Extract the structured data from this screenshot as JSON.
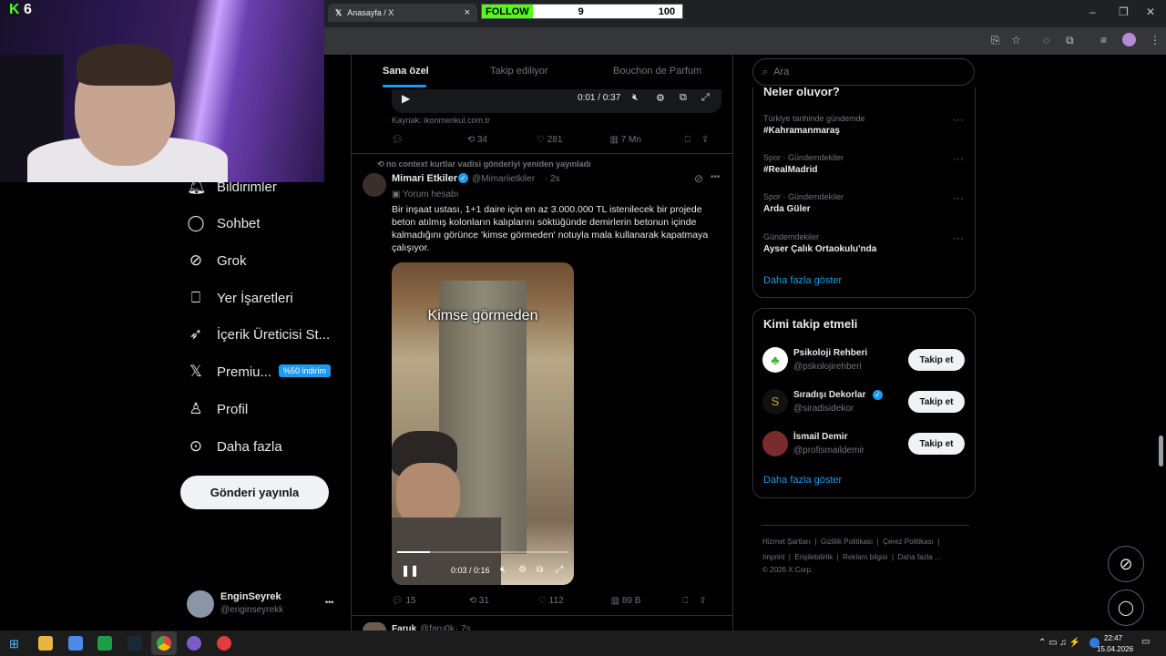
{
  "stream": {
    "logo_k": "K",
    "logo_num": "6"
  },
  "browser": {
    "tab_title": "Anasayfa / X",
    "tab_close": "×",
    "follow_widget": {
      "label": "FOLLOW",
      "current": "9",
      "goal": "100"
    },
    "window_min": "–",
    "window_max": "❐",
    "window_close": "✕"
  },
  "sidebar": {
    "items": [
      {
        "label": "Bildirimler",
        "icon": "bell-icon"
      },
      {
        "label": "Sohbet",
        "icon": "chat-icon"
      },
      {
        "label": "Grok",
        "icon": "grok-icon"
      },
      {
        "label": "Yer İşaretleri",
        "icon": "bookmark-icon"
      },
      {
        "label": "İçerik Üreticisi St...",
        "icon": "rocket-icon"
      },
      {
        "label": "Premiu...",
        "icon": "x-logo-icon"
      },
      {
        "label": "Profil",
        "icon": "person-icon"
      },
      {
        "label": "Daha fazla",
        "icon": "more-circle-icon"
      }
    ],
    "premium_badge": "%50 indirim",
    "post_button": "Gönderi yayınla",
    "account": {
      "name": "EnginSeyrek",
      "handle": "@enginseyrekk",
      "more": "•••"
    }
  },
  "main": {
    "tabs": [
      "Sana özel",
      "Takip ediliyor",
      "Bouchon de Parfum"
    ],
    "prev_video": {
      "time": "0:01 / 0:37",
      "source": "Kaynak: ikonmenkul.com.tr",
      "stats": {
        "retweets": "34",
        "likes": "281",
        "views": "7 Mn"
      }
    },
    "post": {
      "repost_note": "no context kurtlar vadisi gönderiyi yeniden yayınladı",
      "author": "Mimari Etkiler",
      "handle": "@Mimariietkiler",
      "time": "· 2s",
      "subtitle": "Yorum hesabı",
      "text": "Bir inşaat ustası, 1+1 daire için en az 3.000.000 TL istenilecek bir projede beton atılmış kolonların kalıplarını söktüğünde demirlerin betonun içinde kalmadığını görünce 'kimse görmeden' notuyla mala kullanarak kapatmaya çalışıyor.",
      "video_caption": "Kimse görmeden",
      "video_time": "0:03 / 0:16",
      "video_progress": 0.19,
      "stats": {
        "replies": "15",
        "retweets": "31",
        "likes": "112",
        "views": "89 B"
      }
    },
    "next_post": {
      "author": "Faruk",
      "handle": "@faru0k",
      "time": "· 7s"
    }
  },
  "right": {
    "search_placeholder": "Ara",
    "trends_title": "Neler oluyor?",
    "trends": [
      {
        "category": "Türkiye tarihinde gündemde",
        "name": "#Kahramanmaraş"
      },
      {
        "category": "Spor · Gündemdekiler",
        "name": "#RealMadrid"
      },
      {
        "category": "Spor · Gündemdekiler",
        "name": "Arda Güler"
      },
      {
        "category": "Gündemdekiler",
        "name": "Ayser Çalık Ortaokulu'nda"
      }
    ],
    "show_more": "Daha fazla göster",
    "who_title": "Kimi takip etmeli",
    "who": [
      {
        "name": "Psikoloji Rehberi",
        "handle": "@pskolojirehberi",
        "verified": false
      },
      {
        "name": "Sıradışı Dekorlar",
        "handle": "@siradisidekor",
        "verified": true
      },
      {
        "name": "İsmail Demir",
        "handle": "@profismaildemir",
        "verified": false
      }
    ],
    "follow_btn": "Takip et",
    "who_more": "Daha fazla göster",
    "footer": [
      "Hizmet Şartları",
      "Gizlilik Politikası",
      "Çerez Politikası",
      "Imprint",
      "Erişilebilirlik",
      "Reklam bilgisi",
      "Daha fazla ...",
      "© 2026 X Corp."
    ]
  },
  "taskbar": {
    "time": "22:47",
    "date": "15.04.2026"
  }
}
